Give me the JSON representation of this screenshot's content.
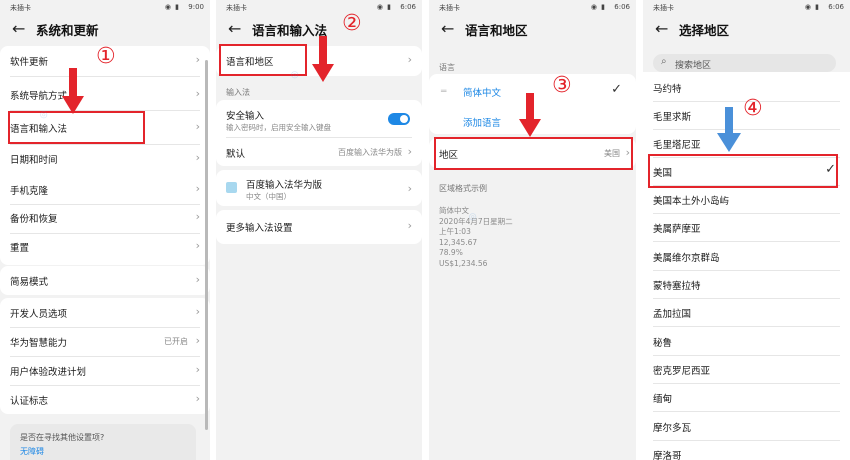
{
  "status": {
    "carrier": "未插卡 ",
    "time1": "9:00",
    "time": "6:06"
  },
  "steps": [
    "①",
    "②",
    "③",
    "④"
  ],
  "panel1": {
    "title": "系统和更新",
    "items": [
      "软件更新",
      "系统导航方式",
      "语言和输入法",
      "日期和时间",
      "手机克隆",
      "备份和恢复",
      "重置",
      "简易模式",
      "开发人员选项",
      "华为智慧能力",
      "用户体验改进计划",
      "认证标志"
    ],
    "smart_value": "已开启",
    "suggest_text": "是否在寻找其他设置项?",
    "suggest_link": "无障碍"
  },
  "panel2": {
    "title": "语言和输入法",
    "lang_region": "语言和地区",
    "input_label": "输入法",
    "secure_title": "安全输入",
    "secure_sub": "输入密码时，启用安全输入键盘",
    "default_label": "默认",
    "default_value": "百度输入法华为版",
    "ime_name": "百度输入法华为版",
    "ime_sub": "中文（中国）",
    "more": "更多输入法设置"
  },
  "panel3": {
    "title": "语言和地区",
    "lang_label": "语言",
    "lang_current": "简体中文",
    "add_lang": "添加语言",
    "region_label": "地区",
    "region_value": "美国",
    "format_label": "区域格式示例",
    "format_lines": [
      "简体中文",
      "2020年4月7日星期二",
      "上午1:03",
      "12,345.67",
      "78.9%",
      "US$1,234.56"
    ]
  },
  "panel4": {
    "title": "选择地区",
    "search_placeholder": "搜索地区",
    "regions": [
      "马约特",
      "毛里求斯",
      "毛里塔尼亚",
      "美国",
      "美国本土外小岛屿",
      "美属萨摩亚",
      "美属维尔京群岛",
      "蒙特塞拉特",
      "孟加拉国",
      "秘鲁",
      "密克罗尼西亚",
      "缅甸",
      "摩尔多瓦",
      "摩洛哥"
    ]
  },
  "colors": {
    "accent": "#1e88e5",
    "highlight": "#e3242b"
  }
}
